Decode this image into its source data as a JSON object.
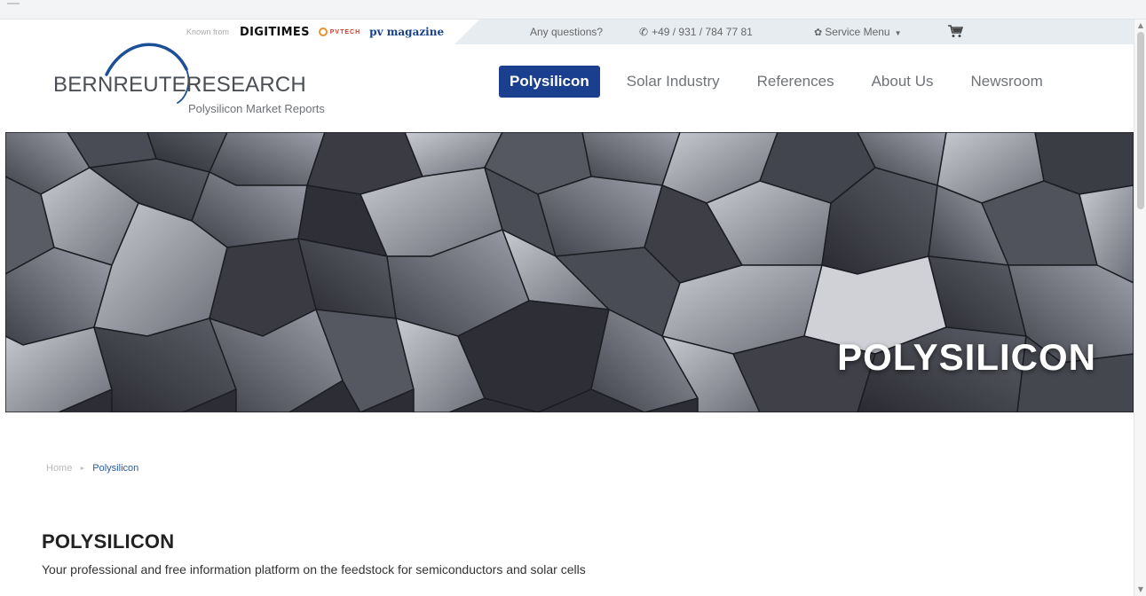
{
  "topbar": {
    "known_from": "Known from",
    "press_logos": [
      "DIGITIMES",
      "PVTECH",
      "pv magazine"
    ],
    "questions": "Any questions?",
    "phone": "+49 / 931 / 784 77 81",
    "service_menu": "Service Menu"
  },
  "brand": {
    "name_left": "BERNREUTER",
    "name_right": "RESEARCH",
    "tagline": "Polysilicon Market Reports"
  },
  "nav": {
    "items": [
      "Polysilicon",
      "Solar Industry",
      "References",
      "About Us",
      "Newsroom"
    ],
    "active": "Polysilicon"
  },
  "hero": {
    "title": "POLYSILICON"
  },
  "breadcrumb": {
    "home": "Home",
    "current": "Polysilicon"
  },
  "page": {
    "title": "POLYSILICON",
    "subtitle": "Your professional and free information platform on the feedstock for semiconductors and solar cells"
  },
  "colors": {
    "accent": "#1b3f8f",
    "topbar_bg": "#e7ecf1"
  }
}
